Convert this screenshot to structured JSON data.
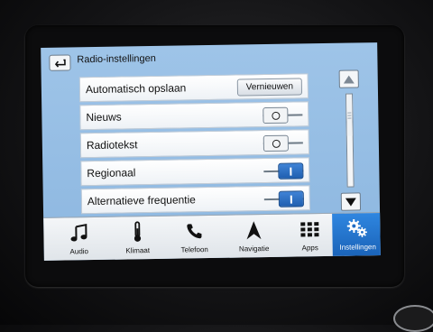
{
  "header": {
    "title": "Radio-instellingen"
  },
  "settings": {
    "items": [
      {
        "label": "Automatisch opslaan",
        "control": "button",
        "button_label": "Vernieuwen"
      },
      {
        "label": "Nieuws",
        "control": "toggle",
        "state": "off"
      },
      {
        "label": "Radiotekst",
        "control": "toggle",
        "state": "off"
      },
      {
        "label": "Regionaal",
        "control": "toggle",
        "state": "on"
      },
      {
        "label": "Alternatieve frequentie",
        "control": "toggle",
        "state": "on"
      }
    ]
  },
  "nav": {
    "items": [
      {
        "label": "Audio",
        "icon": "music-note-icon",
        "active": false
      },
      {
        "label": "Klimaat",
        "icon": "thermometer-icon",
        "active": false
      },
      {
        "label": "Telefoon",
        "icon": "phone-icon",
        "active": false
      },
      {
        "label": "Navigatie",
        "icon": "navigation-arrow-icon",
        "active": false
      },
      {
        "label": "Apps",
        "icon": "apps-grid-icon",
        "active": false
      },
      {
        "label": "Instellingen",
        "icon": "gears-icon",
        "active": true
      }
    ]
  },
  "colors": {
    "accent": "#1f5fb0",
    "screen_bg": "#9ec4e8",
    "active_nav": "#2f86e0"
  }
}
